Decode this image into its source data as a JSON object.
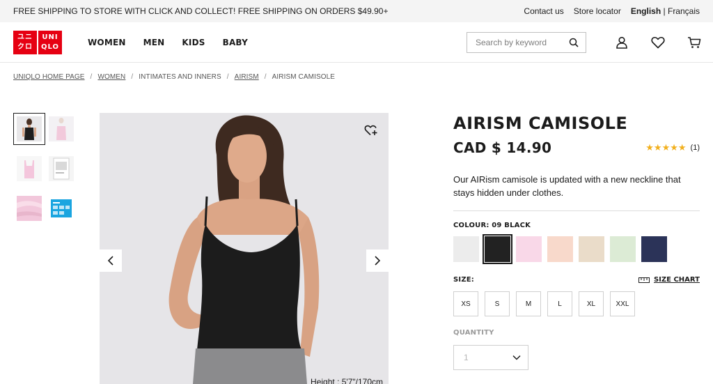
{
  "promo": {
    "text": "FREE SHIPPING TO STORE WITH CLICK AND COLLECT! FREE SHIPPING ON ORDERS $49.90+",
    "contact": "Contact us",
    "store_locator": "Store locator",
    "lang_current": "English",
    "lang_sep": "|",
    "lang_other": "Français"
  },
  "logo": {
    "line1": "ユニ",
    "line2": "クロ",
    "line3": "UNI",
    "line4": "QLO"
  },
  "nav": {
    "women": "WOMEN",
    "men": "MEN",
    "kids": "KIDS",
    "baby": "BABY"
  },
  "search": {
    "placeholder": "Search by keyword"
  },
  "breadcrumb": {
    "items": [
      "UNIQLO HOME PAGE",
      "WOMEN",
      "INTIMATES AND INNERS",
      "AIRISM",
      "AIRISM CAMISOLE"
    ],
    "sep": "/"
  },
  "product": {
    "title": "AIRISM CAMISOLE",
    "price": "CAD $ 14.90",
    "stars": "★★★★★",
    "review_count": "(1)",
    "rating": 5,
    "description": "Our AIRism camisole is updated with a new neckline that stays hidden under clothes.",
    "colour_label": "COLOUR: 09 BLACK",
    "colours": [
      "#ececec",
      "#222222",
      "#f9d8e8",
      "#f8d9cb",
      "#eadcc9",
      "#dcebd5",
      "#2b3358"
    ],
    "selected_colour": 1,
    "size_label": "SIZE:",
    "size_chart": "SIZE CHART",
    "sizes": [
      "XS",
      "S",
      "M",
      "L",
      "XL",
      "XXL"
    ],
    "quantity_label": "QUANTITY",
    "quantity_value": "1",
    "model_height": "Height : 5'7\"/170cm"
  },
  "colors": {
    "brand": "#e60012",
    "star": "#f2b01e"
  }
}
